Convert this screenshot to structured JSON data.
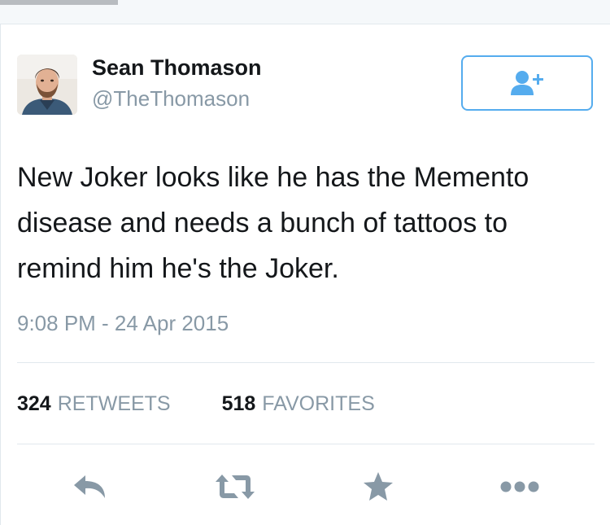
{
  "tweet": {
    "author": {
      "name": "Sean Thomason",
      "handle": "@TheThomason",
      "avatar_icon": "avatar"
    },
    "follow_icon": "add-user-icon",
    "text": "New Joker looks like he has the Memento disease and needs a bunch of tattoos to remind him he's the Joker.",
    "timestamp": "9:08 PM - 24 Apr 2015",
    "stats": {
      "retweets_count": "324",
      "retweets_label": "RETWEETS",
      "favorites_count": "518",
      "favorites_label": "FAVORITES"
    },
    "actions": [
      "reply-icon",
      "retweet-icon",
      "favorite-icon",
      "more-icon"
    ]
  },
  "colors": {
    "accent": "#55acee",
    "icon_gray": "#8899a6",
    "text_dark": "#14171a",
    "divider": "#e1e8ed"
  }
}
